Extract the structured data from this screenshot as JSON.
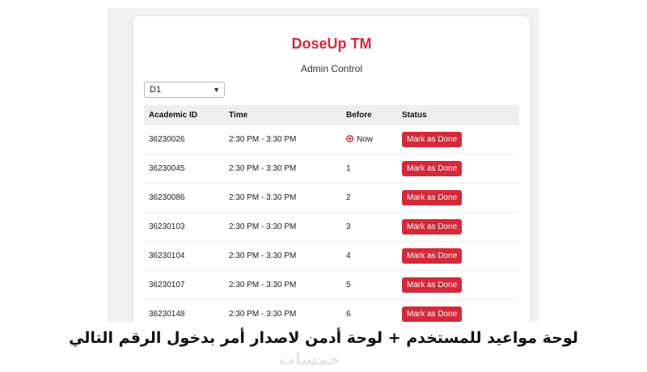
{
  "app": {
    "title": "DoseUp TM",
    "subtitle": "Admin Control"
  },
  "filter": {
    "selected": "D1"
  },
  "table": {
    "headers": [
      "Academic ID",
      "Time",
      "Before",
      "Status"
    ],
    "rows": [
      {
        "id": "36230026",
        "time": "2:30 PM - 3:30 PM",
        "before": "Now",
        "action": "Mark as Done"
      },
      {
        "id": "36230045",
        "time": "2:30 PM - 3:30 PM",
        "before": "1",
        "action": "Mark as Done"
      },
      {
        "id": "36230086",
        "time": "2:30 PM - 3:30 PM",
        "before": "2",
        "action": "Mark as Done"
      },
      {
        "id": "36230103",
        "time": "2:30 PM - 3:30 PM",
        "before": "3",
        "action": "Mark as Done"
      },
      {
        "id": "36230104",
        "time": "2:30 PM - 3:30 PM",
        "before": "4",
        "action": "Mark as Done"
      },
      {
        "id": "36230107",
        "time": "2:30 PM - 3:30 PM",
        "before": "5",
        "action": "Mark as Done"
      },
      {
        "id": "36230148",
        "time": "2:30 PM - 3:30 PM",
        "before": "6",
        "action": "Mark as Done"
      }
    ]
  },
  "caption": "لوحة مواعيد للمستخدم + لوحة أدمن لاصدار أمر بدخول الرقم التالي",
  "watermark": "خمسات",
  "icons": {
    "now": "target-icon",
    "select": "chevron-down-icon"
  },
  "colors": {
    "accent": "#d62839",
    "header_bg": "#eeeeee"
  }
}
